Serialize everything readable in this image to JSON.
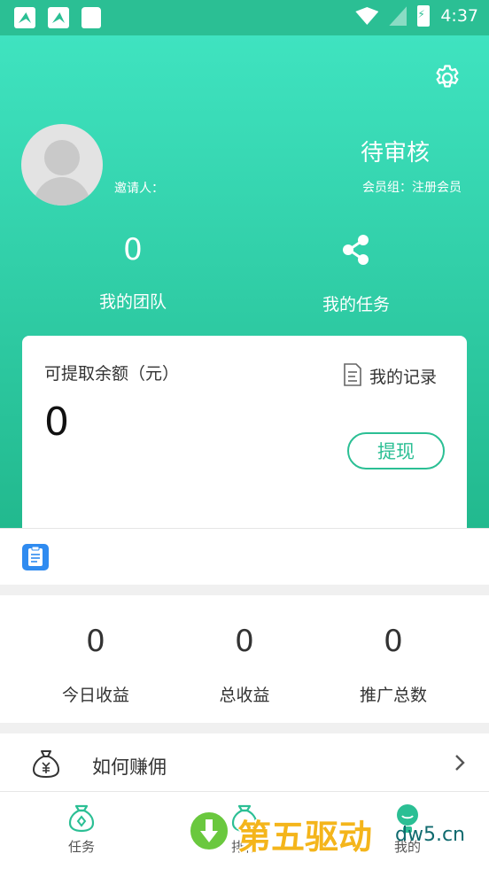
{
  "status_bar": {
    "time": "4:37"
  },
  "header": {
    "inviter_label": "邀请人：",
    "review_status": "待审核",
    "member_group": "会员组：注册会员",
    "team": {
      "count": "0",
      "label": "我的团队"
    },
    "tasks": {
      "label": "我的任务"
    }
  },
  "balance_card": {
    "title": "可提取余额（元）",
    "value": "0",
    "records_label": "我的记录",
    "withdraw_label": "提现"
  },
  "stats": [
    {
      "value": "0",
      "label": "今日收益"
    },
    {
      "value": "0",
      "label": "总收益"
    },
    {
      "value": "0",
      "label": "推广总数"
    }
  ],
  "menu": {
    "earn_label": "如何赚佣"
  },
  "bottom_nav": [
    {
      "label": "任务",
      "icon": "money-bag-icon"
    },
    {
      "label": "排行",
      "icon": "money-bag-icon"
    },
    {
      "label": "我的",
      "icon": "person-icon"
    }
  ],
  "watermark": {
    "text": "第五驱动",
    "domain": "dw5.cn"
  },
  "colors": {
    "accent": "#2bbf94",
    "header_top": "#3fe3c0",
    "header_bottom": "#22b98e"
  }
}
